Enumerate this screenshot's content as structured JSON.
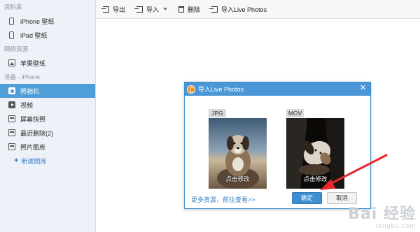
{
  "sidebar": {
    "sections": [
      {
        "header": "资料库",
        "items": [
          {
            "label": "iPhone 壁纸",
            "icon": "phone-icon"
          },
          {
            "label": "iPad 壁纸",
            "icon": "phone-icon"
          }
        ]
      },
      {
        "header": "网络资源",
        "items": [
          {
            "label": "苹果壁纸",
            "icon": "image-icon"
          }
        ]
      },
      {
        "header": "设备 - iPhone",
        "items": [
          {
            "label": "照相机",
            "icon": "camera-icon",
            "active": true
          },
          {
            "label": "视频",
            "icon": "video-icon"
          },
          {
            "label": "屏幕快照",
            "icon": "screenshot-icon"
          },
          {
            "label": "最近删除(2)",
            "icon": "recent-deleted-icon"
          },
          {
            "label": "照片图库",
            "icon": "photo-library-icon"
          }
        ]
      }
    ],
    "add_label": "新建图库"
  },
  "toolbar": {
    "export_label": "导出",
    "import_label": "导入",
    "delete_label": "删除",
    "import_live_label": "导入Live Photos"
  },
  "dialog": {
    "title": "导入Live Photos",
    "cards": [
      {
        "tag": "JPG",
        "caption": "点击修改"
      },
      {
        "tag": "MOV",
        "caption": "点击修改"
      }
    ],
    "more_link": "更多资源，前往查看>>",
    "ok_label": "确定",
    "cancel_label": "取消"
  },
  "watermark": {
    "main": "Bai 经验",
    "sub": "tongbu.com"
  },
  "colors": {
    "accent": "#4f9ed7",
    "dialog_title": "#4a96d6",
    "annotation_arrow": "#e8262b"
  }
}
